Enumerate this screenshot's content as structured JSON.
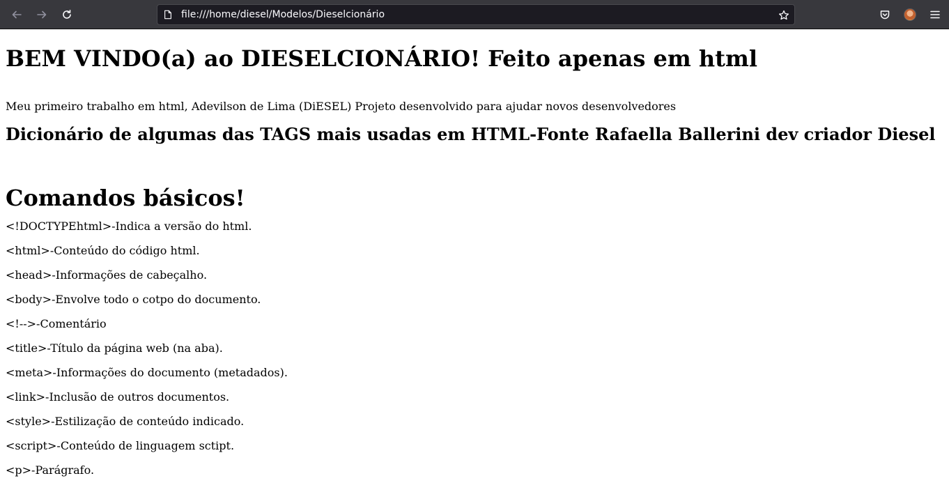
{
  "browser": {
    "url": "file:///home/diesel/Modelos/Dieselcionário",
    "icons": [
      "back-arrow-icon",
      "forward-arrow-icon",
      "reload-icon",
      "page-icon",
      "bookmark-star-icon",
      "pocket-icon",
      "account-avatar",
      "menu-icon"
    ],
    "colors": {
      "toolbar": "#38383d",
      "urlbar": "#1c1b22",
      "text": "#fbfbfe"
    }
  },
  "page": {
    "title": "BEM VINDO(a) ao DIESELCIONÁRIO! Feito apenas em html",
    "intro": "Meu primeiro trabalho em html, Adevilson de Lima (DiESEL) Projeto desenvolvido para ajudar novos desenvolvedores",
    "subtitle": "Dicionário de algumas das TAGS mais usadas em HTML-Fonte Rafaella Ballerini dev criador Diesel",
    "section_title": "Comandos básicos!",
    "items": [
      "<!DOCTYPEhtml>-Indica a versão do html.",
      "<html>-Conteúdo do código html.",
      "<head>-Informações de cabeçalho.",
      "<body>-Envolve todo o cotpo do documento.",
      "<!-->-Comentário",
      "<title>-Título da página web (na aba).",
      "<meta>-Informações do documento (metadados).",
      "<link>-Inclusão de outros documentos.",
      "<style>-Estilização de conteúdo indicado.",
      "<script>-Conteúdo de linguagem sctipt.",
      "<p>-Parágrafo."
    ]
  }
}
